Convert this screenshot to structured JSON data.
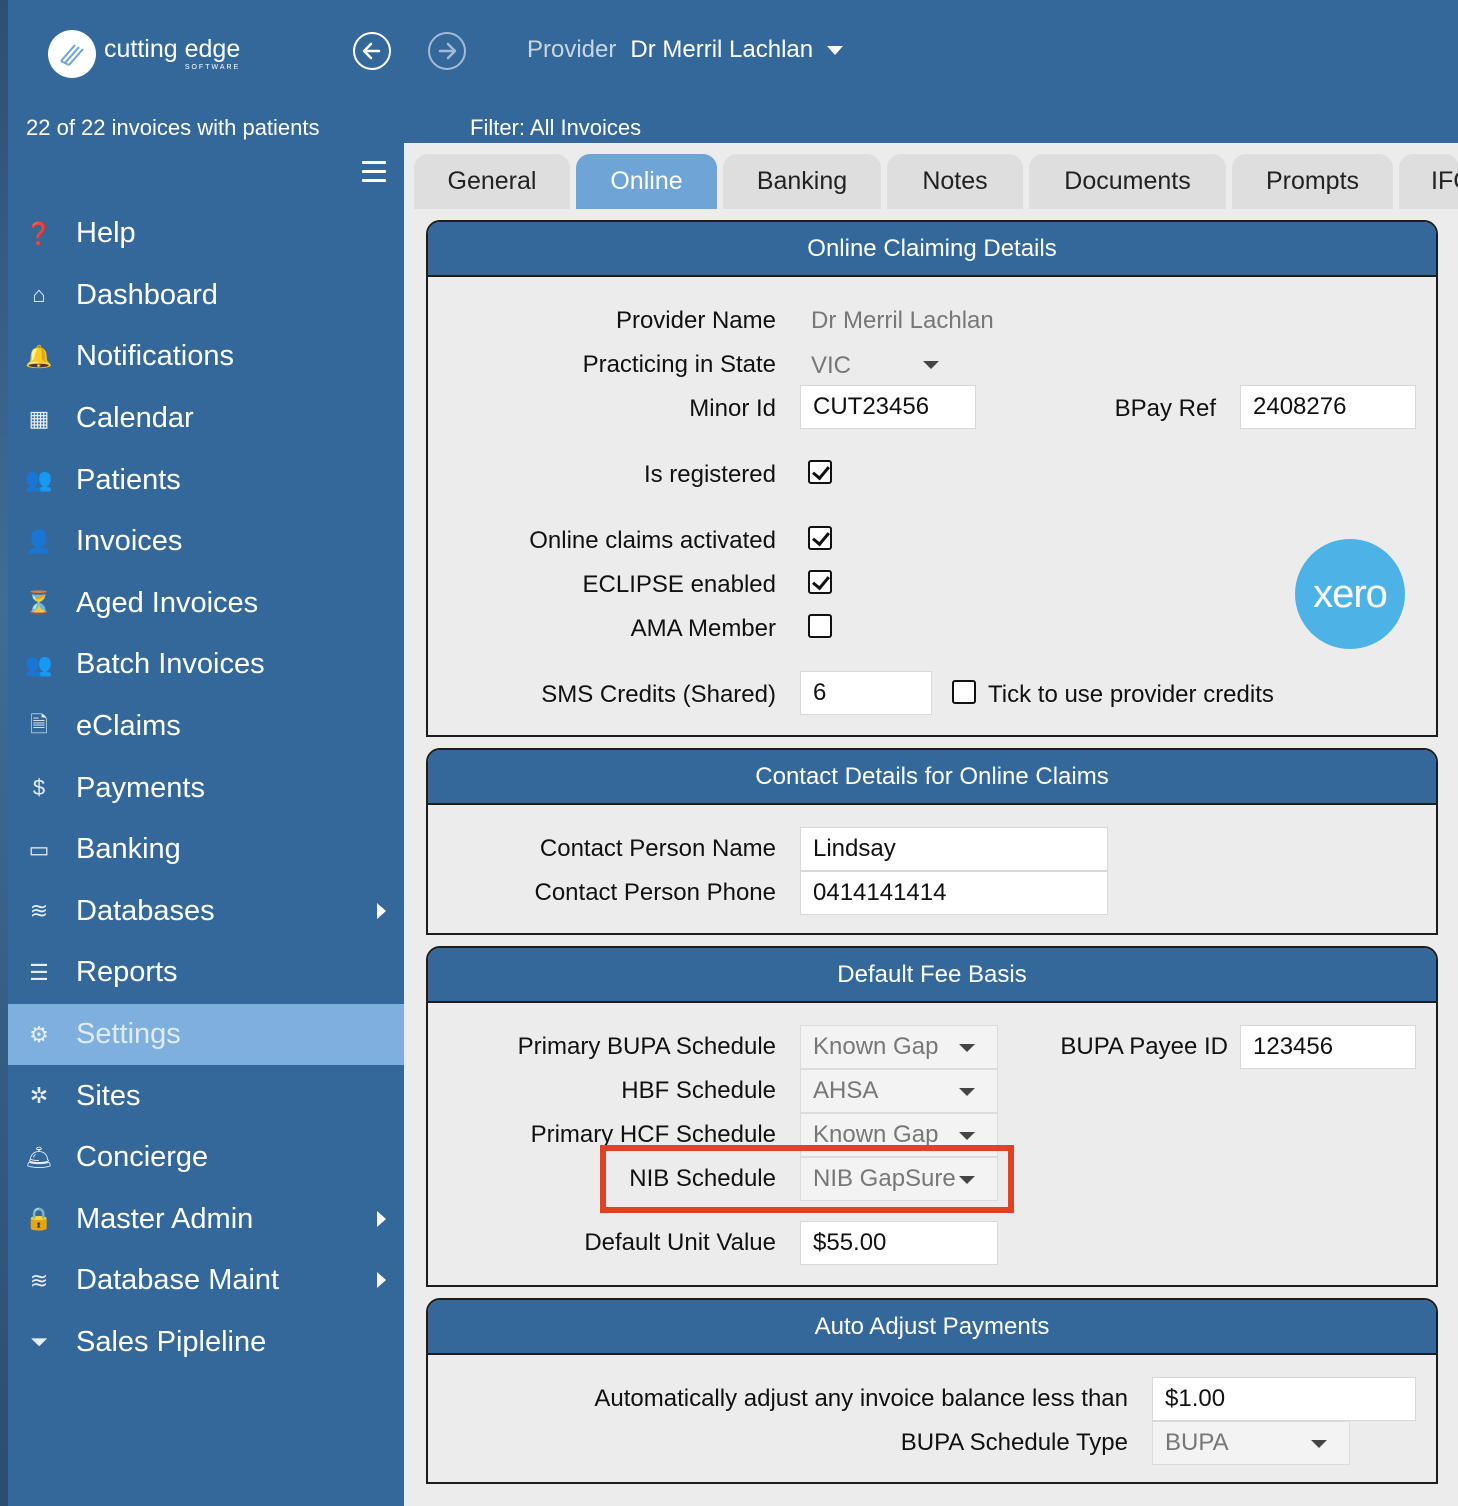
{
  "brand": {
    "name": "cutting edge",
    "sub": "SOFTWARE"
  },
  "header": {
    "provider_label": "Provider",
    "provider_value": "Dr Merril Lachlan",
    "invoice_count": "22 of 22 invoices with patients",
    "filter": "Filter: All Invoices"
  },
  "sidebar": {
    "items": [
      {
        "label": "Help",
        "icon": "help-icon"
      },
      {
        "label": "Dashboard",
        "icon": "home-icon"
      },
      {
        "label": "Notifications",
        "icon": "bell-icon"
      },
      {
        "label": "Calendar",
        "icon": "calendar-icon"
      },
      {
        "label": "Patients",
        "icon": "users-icon"
      },
      {
        "label": "Invoices",
        "icon": "user-icon"
      },
      {
        "label": "Aged Invoices",
        "icon": "aged-invoices-icon"
      },
      {
        "label": "Batch Invoices",
        "icon": "user-group-icon"
      },
      {
        "label": "eClaims",
        "icon": "file-dollar-icon"
      },
      {
        "label": "Payments",
        "icon": "dollar-icon"
      },
      {
        "label": "Banking",
        "icon": "money-check-icon"
      },
      {
        "label": "Databases",
        "icon": "database-icon"
      },
      {
        "label": "Reports",
        "icon": "list-icon"
      },
      {
        "label": "Settings",
        "icon": "user-gear-icon"
      },
      {
        "label": "Sites",
        "icon": "sites-icon"
      },
      {
        "label": "Concierge",
        "icon": "concierge-bell-icon"
      },
      {
        "label": "Master Admin",
        "icon": "user-lock-icon"
      },
      {
        "label": "Database Maint",
        "icon": "database-icon"
      },
      {
        "label": "Sales Pipleline",
        "icon": "funnel-dollar-icon"
      }
    ],
    "active": "Settings"
  },
  "tabs": [
    "General",
    "Online",
    "Banking",
    "Notes",
    "Documents",
    "Prompts",
    "IFC"
  ],
  "active_tab": "Online",
  "online_claiming": {
    "title": "Online Claiming Details",
    "provider_name_label": "Provider Name",
    "provider_name_value": "Dr Merril Lachlan",
    "state_label": "Practicing in State",
    "state_value": "VIC",
    "minor_id_label": "Minor Id",
    "minor_id_value": "CUT23456",
    "bpay_label": "BPay Ref",
    "bpay_value": "2408276",
    "registered_label": "Is registered",
    "registered": true,
    "online_claims_label": "Online claims activated",
    "online_claims": true,
    "eclipse_label": "ECLIPSE enabled",
    "eclipse": true,
    "ama_label": "AMA Member",
    "ama": false,
    "sms_label": "SMS Credits (Shared)",
    "sms_value": "6",
    "provider_credits_label": "Tick to use provider credits",
    "provider_credits": false,
    "xero_logo": "xero"
  },
  "contact": {
    "title": "Contact Details for Online Claims",
    "name_label": "Contact Person Name",
    "name_value": "Lindsay",
    "phone_label": "Contact Person Phone",
    "phone_value": "0414141414"
  },
  "fee_basis": {
    "title": "Default Fee Basis",
    "bupa_label": "Primary BUPA Schedule",
    "bupa_value": "Known Gap",
    "bupa_payee_label": "BUPA Payee ID",
    "bupa_payee_value": "123456",
    "hbf_label": "HBF Schedule",
    "hbf_value": "AHSA",
    "hcf_label": "Primary HCF Schedule",
    "hcf_value": "Known Gap",
    "nib_label": "NIB Schedule",
    "nib_value": "NIB GapSure",
    "unit_label": "Default Unit Value",
    "unit_value": "$55.00"
  },
  "auto_adjust": {
    "title": "Auto Adjust Payments",
    "balance_label": "Automatically adjust any invoice balance less than",
    "balance_value": "$1.00",
    "bupa_type_label": "BUPA Schedule Type",
    "bupa_type_value": "BUPA"
  },
  "colors": {
    "header_blue": "#34689b",
    "active_blue": "#6ea5d6",
    "highlight": "#e2402a",
    "xero": "#4db3e6"
  }
}
